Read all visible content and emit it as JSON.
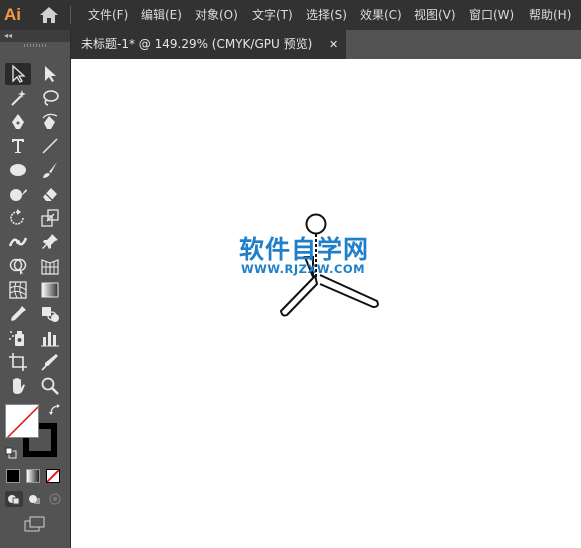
{
  "app": {
    "logo": "Ai"
  },
  "menu": [
    "文件(F)",
    "编辑(E)",
    "对象(O)",
    "文字(T)",
    "选择(S)",
    "效果(C)",
    "视图(V)",
    "窗口(W)",
    "帮助(H)"
  ],
  "toolbar": {
    "collapse": "◂◂"
  },
  "document": {
    "tab_title": "未标题-1* @ 149.29% (CMYK/GPU 预览)",
    "close": "✕"
  },
  "watermark": {
    "title": "软件自学网",
    "url": "WWW.RJZXW.COM"
  },
  "colors": {
    "fill": "#ffffff",
    "stroke": "#000000",
    "none_slash": "#e02020"
  }
}
